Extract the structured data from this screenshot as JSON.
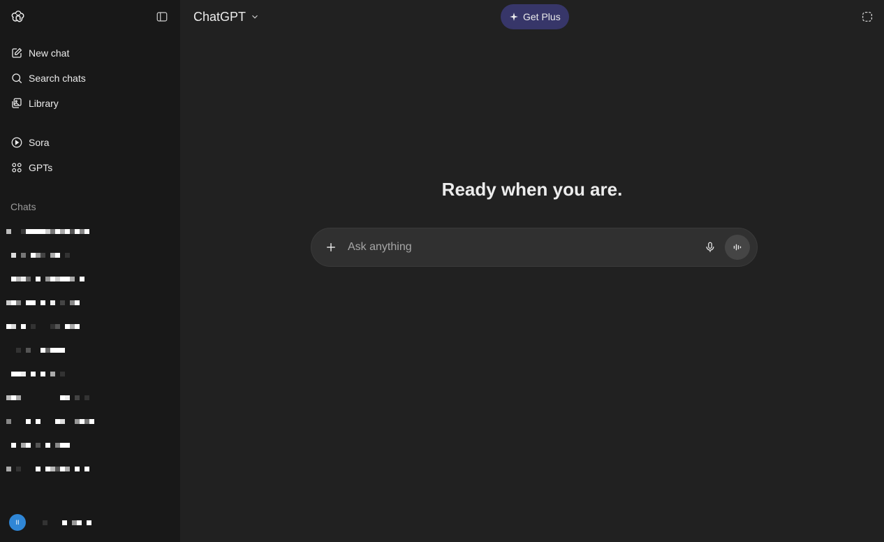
{
  "header": {
    "model_label": "ChatGPT",
    "get_plus_label": "Get Plus"
  },
  "sidebar": {
    "nav": [
      {
        "label": "New chat",
        "icon": "edit-icon"
      },
      {
        "label": "Search chats",
        "icon": "search-icon"
      },
      {
        "label": "Library",
        "icon": "library-icon"
      }
    ],
    "nav2": [
      {
        "label": "Sora",
        "icon": "play-circle-icon"
      },
      {
        "label": "GPTs",
        "icon": "grid-icon"
      }
    ],
    "chats_label": "Chats",
    "user_initials": "II"
  },
  "main": {
    "headline": "Ready when you are.",
    "composer_placeholder": "Ask anything"
  },
  "colors": {
    "sidebar_bg": "#181818",
    "main_bg": "#212121",
    "composer_bg": "#303030",
    "get_plus_bg": "#373669",
    "avatar_bg": "#2f86d6"
  }
}
